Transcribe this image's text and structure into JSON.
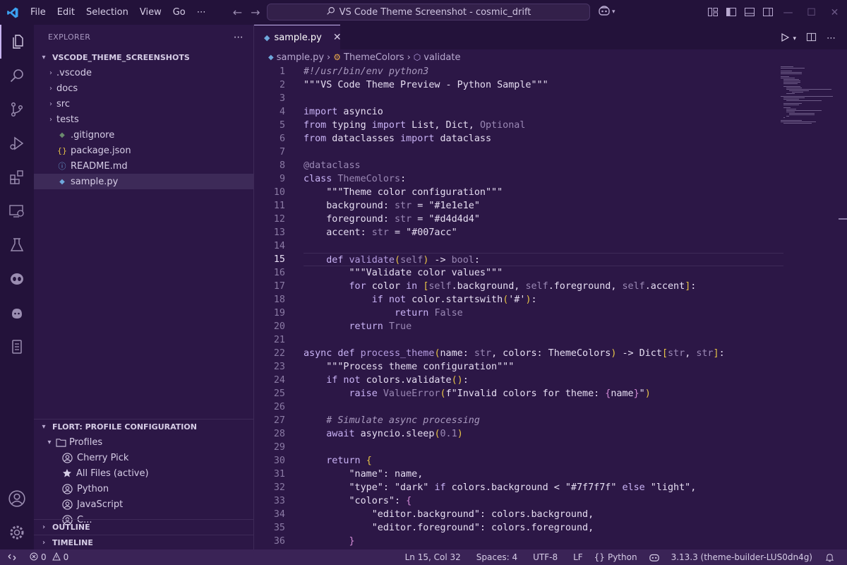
{
  "menu": [
    "File",
    "Edit",
    "Selection",
    "View",
    "Go"
  ],
  "menu_more": "⋯",
  "command_center": "VS Code Theme Screenshot - cosmic_drift",
  "sidebar": {
    "explorer_title": "EXPLORER",
    "workspace_name": "VSCODE_THEME_SCREENSHOTS",
    "tree": [
      {
        "name": ".vscode",
        "kind": "folder"
      },
      {
        "name": "docs",
        "kind": "folder"
      },
      {
        "name": "src",
        "kind": "folder"
      },
      {
        "name": "tests",
        "kind": "folder"
      },
      {
        "name": ".gitignore",
        "kind": "file"
      },
      {
        "name": "package.json",
        "kind": "file"
      },
      {
        "name": "README.md",
        "kind": "file"
      },
      {
        "name": "sample.py",
        "kind": "file",
        "selected": true
      }
    ],
    "profile_section": "FLORT: PROFILE CONFIGURATION",
    "profiles_label": "Profiles",
    "profiles": [
      "Cherry Pick",
      "All Files (active)",
      "Python",
      "JavaScript",
      "C..."
    ],
    "outline": "OUTLINE",
    "timeline": "TIMELINE"
  },
  "tab": {
    "label": "sample.py"
  },
  "breadcrumbs": {
    "file": "sample.py",
    "class": "ThemeColors",
    "method": "validate"
  },
  "editor": {
    "current_line": 15,
    "line_numbers": [
      "1",
      "2",
      "3",
      "4",
      "5",
      "6",
      "7",
      "8",
      "9",
      "10",
      "11",
      "12",
      "13",
      "14",
      "15",
      "16",
      "17",
      "18",
      "19",
      "20",
      "21",
      "22",
      "23",
      "24",
      "25",
      "26",
      "27",
      "28",
      "29",
      "30",
      "31",
      "32",
      "33",
      "34",
      "35",
      "36"
    ],
    "lines": [
      [
        [
          "cm",
          "#!/usr/bin/env python3"
        ]
      ],
      [
        [
          "st",
          "\"\"\"VS Code Theme Preview - Python Sample\"\"\""
        ]
      ],
      [],
      [
        [
          "kw",
          "import"
        ],
        [
          "st",
          " asyncio"
        ]
      ],
      [
        [
          "kw",
          "from"
        ],
        [
          "st",
          " typing "
        ],
        [
          "kw",
          "import"
        ],
        [
          "st",
          " List, Dict, "
        ],
        [
          "ty",
          "Optional"
        ]
      ],
      [
        [
          "kw",
          "from"
        ],
        [
          "st",
          " dataclasses "
        ],
        [
          "kw",
          "import"
        ],
        [
          "st",
          " dataclass"
        ]
      ],
      [],
      [
        [
          "dec",
          "@dataclass"
        ]
      ],
      [
        [
          "kw",
          "class"
        ],
        [
          "st",
          " "
        ],
        [
          "ty",
          "ThemeColors"
        ],
        [
          "st",
          ":"
        ]
      ],
      [
        [
          "st",
          "    \"\"\"Theme color configuration\"\"\""
        ]
      ],
      [
        [
          "st",
          "    background: "
        ],
        [
          "ty",
          "str"
        ],
        [
          "st",
          " = \"#1e1e1e\""
        ]
      ],
      [
        [
          "st",
          "    foreground: "
        ],
        [
          "ty",
          "str"
        ],
        [
          "st",
          " = \"#d4d4d4\""
        ]
      ],
      [
        [
          "st",
          "    accent: "
        ],
        [
          "ty",
          "str"
        ],
        [
          "st",
          " = \"#007acc\""
        ]
      ],
      [],
      [
        [
          "st",
          "    "
        ],
        [
          "kw",
          "def"
        ],
        [
          "st",
          " "
        ],
        [
          "fn",
          "validate"
        ],
        [
          "br",
          "("
        ],
        [
          "ty",
          "self"
        ],
        [
          "br",
          ")"
        ],
        [
          "st",
          " -> "
        ],
        [
          "ty",
          "bool"
        ],
        [
          "st",
          ":"
        ]
      ],
      [
        [
          "st",
          "        \"\"\"Validate color values\"\"\""
        ]
      ],
      [
        [
          "st",
          "        "
        ],
        [
          "kw",
          "for"
        ],
        [
          "st",
          " color "
        ],
        [
          "kw",
          "in"
        ],
        [
          "st",
          " "
        ],
        [
          "br",
          "["
        ],
        [
          "ty",
          "self"
        ],
        [
          "st",
          ".background, "
        ],
        [
          "ty",
          "self"
        ],
        [
          "st",
          ".foreground, "
        ],
        [
          "ty",
          "self"
        ],
        [
          "st",
          ".accent"
        ],
        [
          "br",
          "]"
        ],
        [
          "st",
          ":"
        ]
      ],
      [
        [
          "st",
          "            "
        ],
        [
          "kw",
          "if not"
        ],
        [
          "st",
          " color.startswith"
        ],
        [
          "br",
          "("
        ],
        [
          "st",
          "'#'"
        ],
        [
          "br",
          ")"
        ],
        [
          "st",
          ":"
        ]
      ],
      [
        [
          "st",
          "                "
        ],
        [
          "kw",
          "return"
        ],
        [
          "st",
          " "
        ],
        [
          "ty",
          "False"
        ]
      ],
      [
        [
          "st",
          "        "
        ],
        [
          "kw",
          "return"
        ],
        [
          "st",
          " "
        ],
        [
          "ty",
          "True"
        ]
      ],
      [],
      [
        [
          "kw",
          "async def"
        ],
        [
          "st",
          " "
        ],
        [
          "fn",
          "process_theme"
        ],
        [
          "br",
          "("
        ],
        [
          "st",
          "name: "
        ],
        [
          "ty",
          "str"
        ],
        [
          "st",
          ", colors: ThemeColors"
        ],
        [
          "br",
          ")"
        ],
        [
          "st",
          " -> Dict"
        ],
        [
          "br",
          "["
        ],
        [
          "ty",
          "str"
        ],
        [
          "st",
          ", "
        ],
        [
          "ty",
          "str"
        ],
        [
          "br",
          "]"
        ],
        [
          "st",
          ":"
        ]
      ],
      [
        [
          "st",
          "    \"\"\"Process theme configuration\"\"\""
        ]
      ],
      [
        [
          "st",
          "    "
        ],
        [
          "kw",
          "if not"
        ],
        [
          "st",
          " colors.validate"
        ],
        [
          "br",
          "()"
        ],
        [
          "st",
          ":"
        ]
      ],
      [
        [
          "st",
          "        "
        ],
        [
          "kw",
          "raise"
        ],
        [
          "st",
          " "
        ],
        [
          "ty",
          "ValueError"
        ],
        [
          "br",
          "("
        ],
        [
          "st",
          "f\"Invalid colors for theme: "
        ],
        [
          "br2",
          "{"
        ],
        [
          "st",
          "name"
        ],
        [
          "br2",
          "}"
        ],
        [
          "st",
          "\""
        ],
        [
          "br",
          ")"
        ]
      ],
      [],
      [
        [
          "cm",
          "    # Simulate async processing"
        ]
      ],
      [
        [
          "st",
          "    "
        ],
        [
          "kw",
          "await"
        ],
        [
          "st",
          " asyncio.sleep"
        ],
        [
          "br",
          "("
        ],
        [
          "ty",
          "0.1"
        ],
        [
          "br",
          ")"
        ]
      ],
      [],
      [
        [
          "st",
          "    "
        ],
        [
          "kw",
          "return"
        ],
        [
          "st",
          " "
        ],
        [
          "br",
          "{"
        ]
      ],
      [
        [
          "st",
          "        \"name\": name,"
        ]
      ],
      [
        [
          "st",
          "        \"type\": \"dark\" "
        ],
        [
          "kw",
          "if"
        ],
        [
          "st",
          " colors.background < \"#7f7f7f\" "
        ],
        [
          "kw",
          "else"
        ],
        [
          "st",
          " \"light\","
        ]
      ],
      [
        [
          "st",
          "        \"colors\": "
        ],
        [
          "br2",
          "{"
        ]
      ],
      [
        [
          "st",
          "            \"editor.background\": colors.background,"
        ]
      ],
      [
        [
          "st",
          "            \"editor.foreground\": colors.foreground,"
        ]
      ],
      [
        [
          "st",
          "        "
        ],
        [
          "br2",
          "}"
        ]
      ]
    ]
  },
  "statusbar": {
    "errors": "0",
    "warnings": "0",
    "position": "Ln 15, Col 32",
    "spaces": "Spaces: 4",
    "encoding": "UTF-8",
    "eol": "LF",
    "language": "Python",
    "interpreter": "3.13.3 (theme-builder-LUS0dn4g)"
  },
  "colors": {
    "accent": "#c8b4f0",
    "background": "#2c1746",
    "statusbar": "#3a2356"
  }
}
